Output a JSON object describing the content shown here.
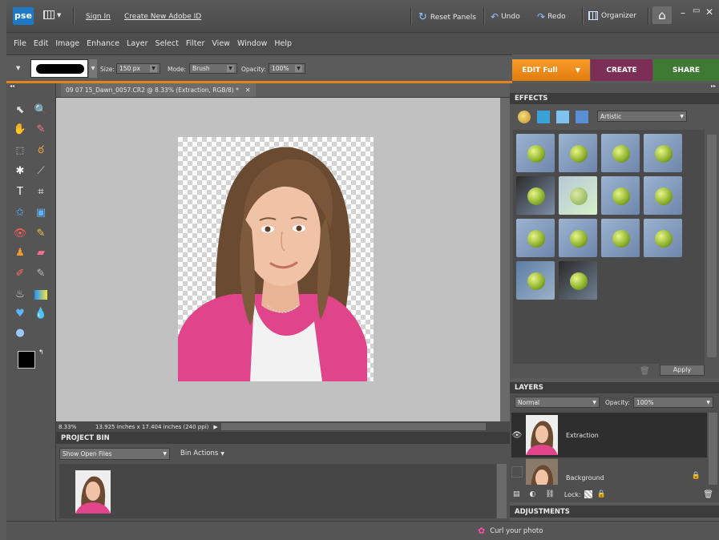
{
  "app": {
    "logo": "pse"
  },
  "topbar": {
    "sign_in": "Sign In",
    "create_id": "Create New Adobe ID",
    "reset_panels": "Reset Panels",
    "undo": "Undo",
    "redo": "Redo",
    "organizer": "Organizer"
  },
  "menu": [
    "File",
    "Edit",
    "Image",
    "Enhance",
    "Layer",
    "Select",
    "Filter",
    "View",
    "Window",
    "Help"
  ],
  "options": {
    "size_label": "Size:",
    "size_value": "150 px",
    "mode_label": "Mode:",
    "mode_value": "Brush",
    "opacity_label": "Opacity:",
    "opacity_value": "100%"
  },
  "mode_tabs": {
    "edit": "EDIT Full",
    "create": "CREATE",
    "share": "SHARE"
  },
  "document": {
    "tab_title": "09 07 15_Dawn_0057.CR2 @ 8.33% (Extraction, RGB/8) *",
    "zoom": "8.33%",
    "dimensions": "13.925 inches x 17.404 inches (240 ppi)"
  },
  "project_bin": {
    "title": "PROJECT BIN",
    "show_select": "Show Open Files",
    "bin_actions": "Bin Actions"
  },
  "effects": {
    "title": "EFFECTS",
    "category": "Artistic",
    "apply": "Apply",
    "thumb_count": 14
  },
  "layers": {
    "title": "LAYERS",
    "blend_mode": "Normal",
    "opacity_label": "Opacity:",
    "opacity_value": "100%",
    "items": [
      {
        "name": "Extraction",
        "selected": true
      },
      {
        "name": "Background",
        "selected": false
      }
    ],
    "lock_label": "Lock:"
  },
  "adjustments": {
    "title": "ADJUSTMENTS"
  },
  "status": {
    "tip": "Curl your photo"
  },
  "colors": {
    "edit_tab": "#f0890f",
    "create_tab": "#7d2e56",
    "share_tab": "#3f7a33",
    "logo_blue": "#1d79c7"
  },
  "icons": [
    "grid-icon",
    "refresh-icon",
    "undo-icon",
    "redo-icon",
    "organizer-icon",
    "home-icon",
    "minimize-icon",
    "maximize-icon",
    "close-icon",
    "paw-icon",
    "trash-icon",
    "eye-icon",
    "lock-icon"
  ]
}
